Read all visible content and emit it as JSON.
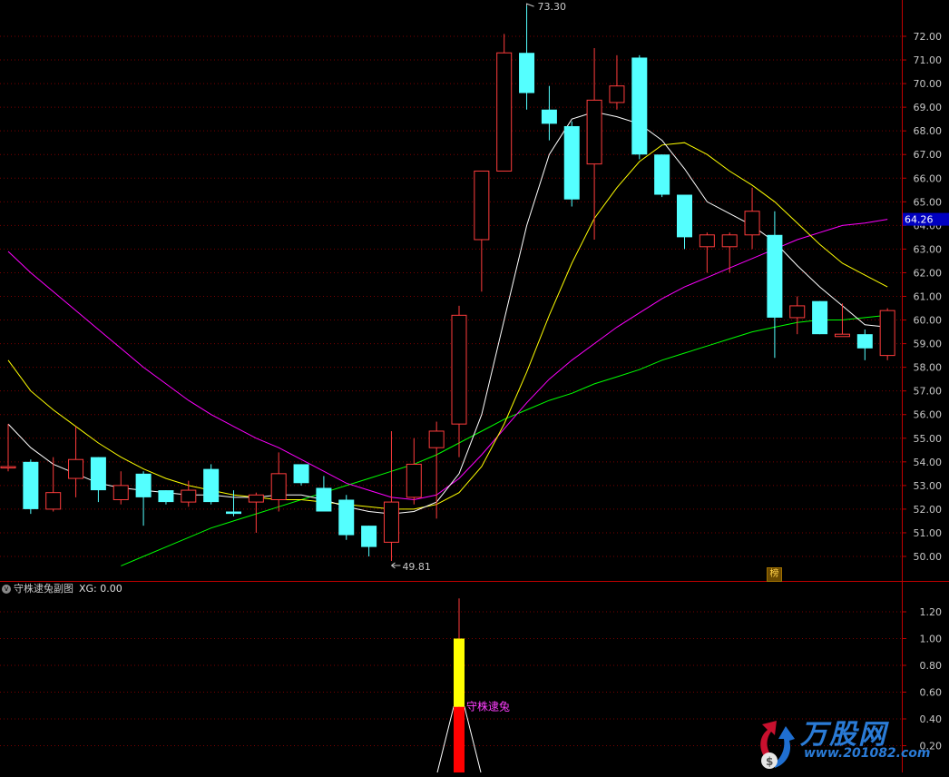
{
  "chart_data": {
    "type": "candlestick",
    "price_axis": {
      "range": [
        49.4,
        73.3
      ],
      "ticks": [
        50,
        51,
        52,
        53,
        54,
        55,
        56,
        57,
        58,
        59,
        60,
        61,
        62,
        63,
        64,
        65,
        66,
        67,
        68,
        69,
        70,
        71,
        72
      ],
      "tick_labels": [
        "50.00",
        "51.00",
        "52.00",
        "53.00",
        "54.00",
        "55.00",
        "56.00",
        "57.00",
        "58.00",
        "59.00",
        "60.00",
        "61.00",
        "62.00",
        "63.00",
        "64.00",
        "65.00",
        "66.00",
        "67.00",
        "68.00",
        "69.00",
        "70.00",
        "71.00",
        "72.00"
      ],
      "current_price_label": "64.26",
      "current_price": 64.26
    },
    "annotations": {
      "high_label": "73.30",
      "high_value": 73.3,
      "high_index": 23,
      "low_label": "49.81",
      "low_value": 49.81,
      "low_index": 17
    },
    "candles": [
      {
        "o": 53.8,
        "h": 55.6,
        "l": 53.6,
        "c": 53.8
      },
      {
        "o": 54.0,
        "h": 54.1,
        "l": 51.8,
        "c": 52.0
      },
      {
        "o": 52.0,
        "h": 54.2,
        "l": 51.9,
        "c": 52.7
      },
      {
        "o": 53.3,
        "h": 55.5,
        "l": 52.5,
        "c": 54.1
      },
      {
        "o": 54.2,
        "h": 54.2,
        "l": 52.3,
        "c": 52.8
      },
      {
        "o": 52.4,
        "h": 53.6,
        "l": 52.2,
        "c": 53.0
      },
      {
        "o": 53.5,
        "h": 53.6,
        "l": 51.3,
        "c": 52.5
      },
      {
        "o": 52.8,
        "h": 52.8,
        "l": 52.2,
        "c": 52.3
      },
      {
        "o": 52.3,
        "h": 53.2,
        "l": 52.1,
        "c": 52.8
      },
      {
        "o": 53.7,
        "h": 53.9,
        "l": 52.2,
        "c": 52.3
      },
      {
        "o": 51.9,
        "h": 52.8,
        "l": 51.7,
        "c": 51.8
      },
      {
        "o": 52.3,
        "h": 52.7,
        "l": 51.0,
        "c": 52.6
      },
      {
        "o": 52.4,
        "h": 54.4,
        "l": 51.9,
        "c": 53.5
      },
      {
        "o": 53.9,
        "h": 53.9,
        "l": 53.0,
        "c": 53.1
      },
      {
        "o": 52.9,
        "h": 53.4,
        "l": 51.9,
        "c": 51.9
      },
      {
        "o": 52.4,
        "h": 52.6,
        "l": 50.7,
        "c": 50.9
      },
      {
        "o": 51.3,
        "h": 51.3,
        "l": 50.0,
        "c": 50.4
      },
      {
        "o": 50.6,
        "h": 55.3,
        "l": 49.81,
        "c": 52.3
      },
      {
        "o": 52.5,
        "h": 55.0,
        "l": 52.2,
        "c": 53.9
      },
      {
        "o": 54.6,
        "h": 55.7,
        "l": 51.6,
        "c": 55.3
      },
      {
        "o": 55.6,
        "h": 60.6,
        "l": 54.2,
        "c": 60.2
      },
      {
        "o": 63.4,
        "h": 64.8,
        "l": 61.2,
        "c": 66.3
      },
      {
        "o": 66.3,
        "h": 72.1,
        "l": 66.3,
        "c": 71.3
      },
      {
        "o": 71.3,
        "h": 73.3,
        "l": 68.9,
        "c": 69.6
      },
      {
        "o": 68.9,
        "h": 69.9,
        "l": 67.6,
        "c": 68.3
      },
      {
        "o": 68.2,
        "h": 68.4,
        "l": 64.8,
        "c": 65.1
      },
      {
        "o": 66.6,
        "h": 71.5,
        "l": 63.4,
        "c": 69.3
      },
      {
        "o": 69.2,
        "h": 71.2,
        "l": 68.9,
        "c": 69.9
      },
      {
        "o": 71.1,
        "h": 71.2,
        "l": 66.8,
        "c": 67.0
      },
      {
        "o": 67.0,
        "h": 67.0,
        "l": 65.2,
        "c": 65.3
      },
      {
        "o": 65.3,
        "h": 65.3,
        "l": 63.0,
        "c": 63.5
      },
      {
        "o": 63.1,
        "h": 63.7,
        "l": 62.0,
        "c": 63.6
      },
      {
        "o": 63.1,
        "h": 63.7,
        "l": 62.0,
        "c": 63.6
      },
      {
        "o": 63.6,
        "h": 65.6,
        "l": 63.0,
        "c": 64.6
      },
      {
        "o": 63.6,
        "h": 64.6,
        "l": 58.4,
        "c": 60.1
      },
      {
        "o": 60.1,
        "h": 61.0,
        "l": 59.4,
        "c": 60.6
      },
      {
        "o": 60.8,
        "h": 60.8,
        "l": 59.4,
        "c": 59.4
      },
      {
        "o": 59.3,
        "h": 60.7,
        "l": 59.3,
        "c": 59.4
      },
      {
        "o": 59.4,
        "h": 59.6,
        "l": 58.3,
        "c": 58.8
      },
      {
        "o": 58.5,
        "h": 60.5,
        "l": 58.3,
        "c": 60.4
      }
    ],
    "ma_white": [
      55.6,
      54.6,
      53.9,
      53.5,
      53.1,
      52.9,
      52.8,
      52.7,
      52.6,
      52.6,
      52.5,
      52.5,
      52.6,
      52.6,
      52.4,
      52.1,
      51.9,
      51.8,
      51.9,
      52.3,
      53.5,
      56.0,
      60.0,
      64.0,
      67.0,
      68.5,
      68.8,
      68.6,
      68.3,
      67.6,
      66.4,
      65.0,
      64.5,
      64.0,
      63.3,
      62.3,
      61.4,
      60.6,
      59.8,
      59.7
    ],
    "ma_yellow": [
      58.3,
      57.0,
      56.2,
      55.5,
      54.8,
      54.2,
      53.7,
      53.3,
      53.0,
      52.8,
      52.6,
      52.5,
      52.4,
      52.4,
      52.3,
      52.2,
      52.1,
      52.0,
      52.0,
      52.2,
      52.7,
      53.8,
      55.6,
      57.8,
      60.2,
      62.4,
      64.3,
      65.6,
      66.7,
      67.4,
      67.5,
      67.0,
      66.3,
      65.7,
      65.0,
      64.1,
      63.2,
      62.4,
      61.9,
      61.4
    ],
    "ma_magenta": [
      62.9,
      62.0,
      61.2,
      60.4,
      59.6,
      58.8,
      58.0,
      57.3,
      56.6,
      56.0,
      55.5,
      55.0,
      54.6,
      54.1,
      53.6,
      53.1,
      52.8,
      52.5,
      52.4,
      52.6,
      53.3,
      54.3,
      55.4,
      56.5,
      57.5,
      58.3,
      59.0,
      59.7,
      60.3,
      60.9,
      61.4,
      61.8,
      62.2,
      62.6,
      63.0,
      63.4,
      63.7,
      64.0,
      64.1,
      64.26
    ],
    "ma_green": [
      null,
      null,
      null,
      null,
      null,
      49.6,
      50.0,
      50.4,
      50.8,
      51.2,
      51.5,
      51.8,
      52.1,
      52.4,
      52.7,
      53.0,
      53.3,
      53.6,
      53.9,
      54.3,
      54.8,
      55.3,
      55.8,
      56.2,
      56.6,
      56.9,
      57.3,
      57.6,
      57.9,
      58.3,
      58.6,
      58.9,
      59.2,
      59.5,
      59.7,
      59.9,
      60.0,
      60.0,
      60.1,
      60.2
    ],
    "indicator": {
      "name": "守株逮兔副图",
      "xg_label": "XG: 0.00",
      "signal_label": "守株逮兔",
      "axis_ticks": [
        0.2,
        0.4,
        0.6,
        0.8,
        1.0,
        1.2
      ],
      "axis_tick_labels": [
        "0.20",
        "0.40",
        "0.60",
        "0.80",
        "1.00",
        "1.20"
      ],
      "range": [
        0,
        1.3
      ],
      "signal_index": 20,
      "signal_bar": {
        "red_top": 0.49,
        "yellow_top": 1.0,
        "wick_top": 1.3
      }
    },
    "colors": {
      "up": "#ff3c3c",
      "down": "#54ffff",
      "ma_white": "#ffffff",
      "ma_yellow": "#ffff00",
      "ma_magenta": "#ff00ff",
      "ma_green": "#00ff00",
      "axis": "#c00000",
      "grid": "#7a0000",
      "tick_text": "#c8c8c8",
      "price_box": "#0000c0"
    }
  },
  "badge_label": "榜",
  "logo": {
    "brand": "万股网",
    "url": "www.201082.com"
  }
}
